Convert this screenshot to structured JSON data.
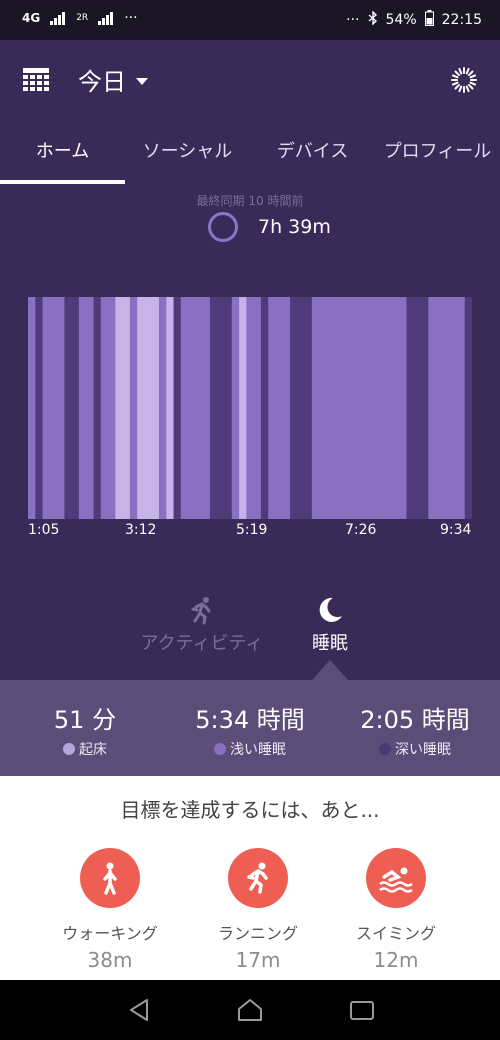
{
  "status_bar": {
    "network": "4G",
    "sim2_label": "2R",
    "more_left": "···",
    "more_right": "···",
    "battery": "54%",
    "time": "22:15"
  },
  "header": {
    "date_label": "今日"
  },
  "tabs": [
    {
      "label": "ホーム",
      "active": true
    },
    {
      "label": "ソーシャル",
      "active": false
    },
    {
      "label": "デバイス",
      "active": false
    },
    {
      "label": "プロフィール",
      "active": false
    }
  ],
  "sync": {
    "text": "最終同期 10 時間前"
  },
  "sleep_total": "7h 39m",
  "modes": {
    "activity": "アクティビティ",
    "sleep": "睡眠"
  },
  "stats": [
    {
      "value": "51 分",
      "label": "起床",
      "color": "#b8a5dc"
    },
    {
      "value": "5:34 時間",
      "label": "浅い睡眠",
      "color": "#8a70c2"
    },
    {
      "value": "2:05 時間",
      "label": "深い睡眠",
      "color": "#4a3a72"
    }
  ],
  "goals": {
    "title": "目標を達成するには、あと...",
    "items": [
      {
        "name": "ウォーキング",
        "amount": "38m",
        "icon": "walking-icon"
      },
      {
        "name": "ランニング",
        "amount": "17m",
        "icon": "running-icon"
      },
      {
        "name": "スイミング",
        "amount": "12m",
        "icon": "swimming-icon"
      }
    ]
  },
  "colors": {
    "background": "#3a2a58",
    "awake": "#c6b4e8",
    "light": "#8a70c2",
    "deep": "#4e3b7a",
    "accent": "#ee5e52"
  },
  "chart_data": {
    "type": "heatmap",
    "x_tick_labels": [
      "1:05",
      "3:12",
      "5:19",
      "7:26",
      "9:34"
    ],
    "stages_legend": [
      "起床",
      "浅い睡眠",
      "深い睡眠"
    ],
    "segments": [
      {
        "stage": "light",
        "duration": 1
      },
      {
        "stage": "deep",
        "duration": 1
      },
      {
        "stage": "light",
        "duration": 3
      },
      {
        "stage": "deep",
        "duration": 2
      },
      {
        "stage": "light",
        "duration": 2
      },
      {
        "stage": "deep",
        "duration": 1
      },
      {
        "stage": "light",
        "duration": 2
      },
      {
        "stage": "awake",
        "duration": 2
      },
      {
        "stage": "light",
        "duration": 1
      },
      {
        "stage": "awake",
        "duration": 3
      },
      {
        "stage": "light",
        "duration": 1
      },
      {
        "stage": "awake",
        "duration": 1
      },
      {
        "stage": "deep",
        "duration": 1
      },
      {
        "stage": "light",
        "duration": 4
      },
      {
        "stage": "deep",
        "duration": 3
      },
      {
        "stage": "light",
        "duration": 1
      },
      {
        "stage": "awake",
        "duration": 1
      },
      {
        "stage": "light",
        "duration": 2
      },
      {
        "stage": "deep",
        "duration": 1
      },
      {
        "stage": "light",
        "duration": 3
      },
      {
        "stage": "deep",
        "duration": 3
      },
      {
        "stage": "light",
        "duration": 13
      },
      {
        "stage": "deep",
        "duration": 3
      },
      {
        "stage": "light",
        "duration": 5
      },
      {
        "stage": "deep",
        "duration": 1
      }
    ]
  }
}
